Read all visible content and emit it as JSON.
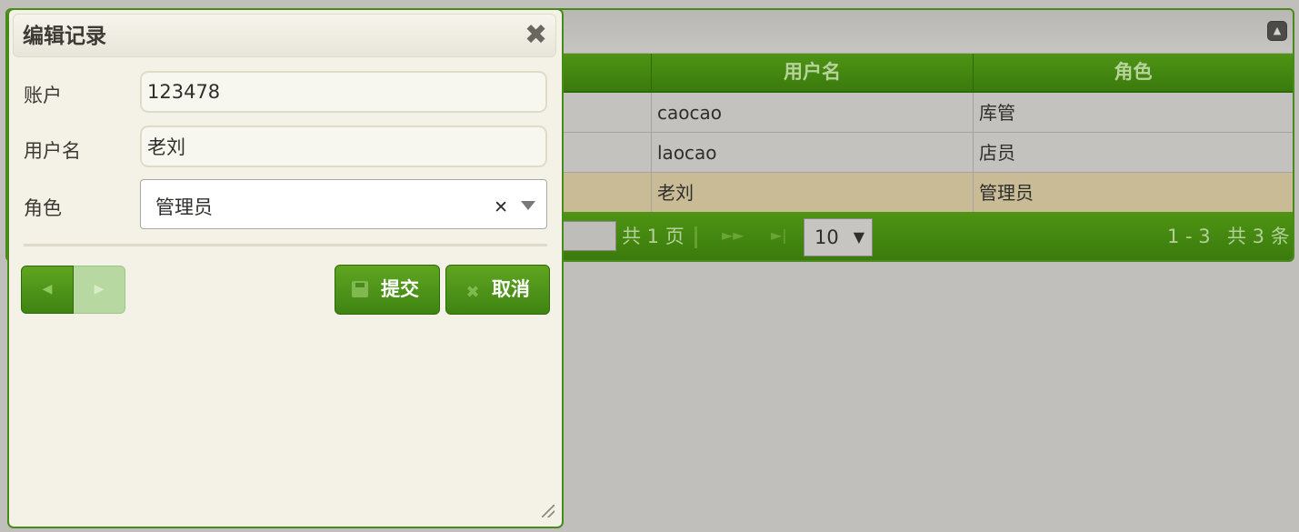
{
  "grid": {
    "columns": [
      {
        "label": ""
      },
      {
        "label": "用户名"
      },
      {
        "label": "角色"
      }
    ],
    "rows": [
      {
        "account": "",
        "username": "caocao",
        "role": "库管",
        "selected": false
      },
      {
        "account": "",
        "username": "laocao",
        "role": "店员",
        "selected": false
      },
      {
        "account": "",
        "username": "老刘",
        "role": "管理员",
        "selected": true
      }
    ],
    "pager": {
      "current_page": "",
      "total_pages_text": "共 1 页",
      "page_size": "10",
      "range_text": "1 - 3",
      "total_text": "共 3 条"
    }
  },
  "dialog": {
    "title": "编辑记录",
    "fields": {
      "account": {
        "label": "账户",
        "value": "123478"
      },
      "username": {
        "label": "用户名",
        "value": "老刘"
      },
      "role": {
        "label": "角色",
        "value": "管理员"
      }
    },
    "buttons": {
      "submit": "提交",
      "cancel": "取消"
    }
  },
  "icons": {
    "close": "close-icon",
    "collapse": "collapse-icon",
    "prev": "triangle-left-icon",
    "next": "triangle-right-icon",
    "save": "save-icon",
    "cancel": "close-icon"
  },
  "colors": {
    "accent": "#4a8a1c",
    "selected_row": "#c8bb96",
    "dialog_bg": "#f4f2e6"
  }
}
